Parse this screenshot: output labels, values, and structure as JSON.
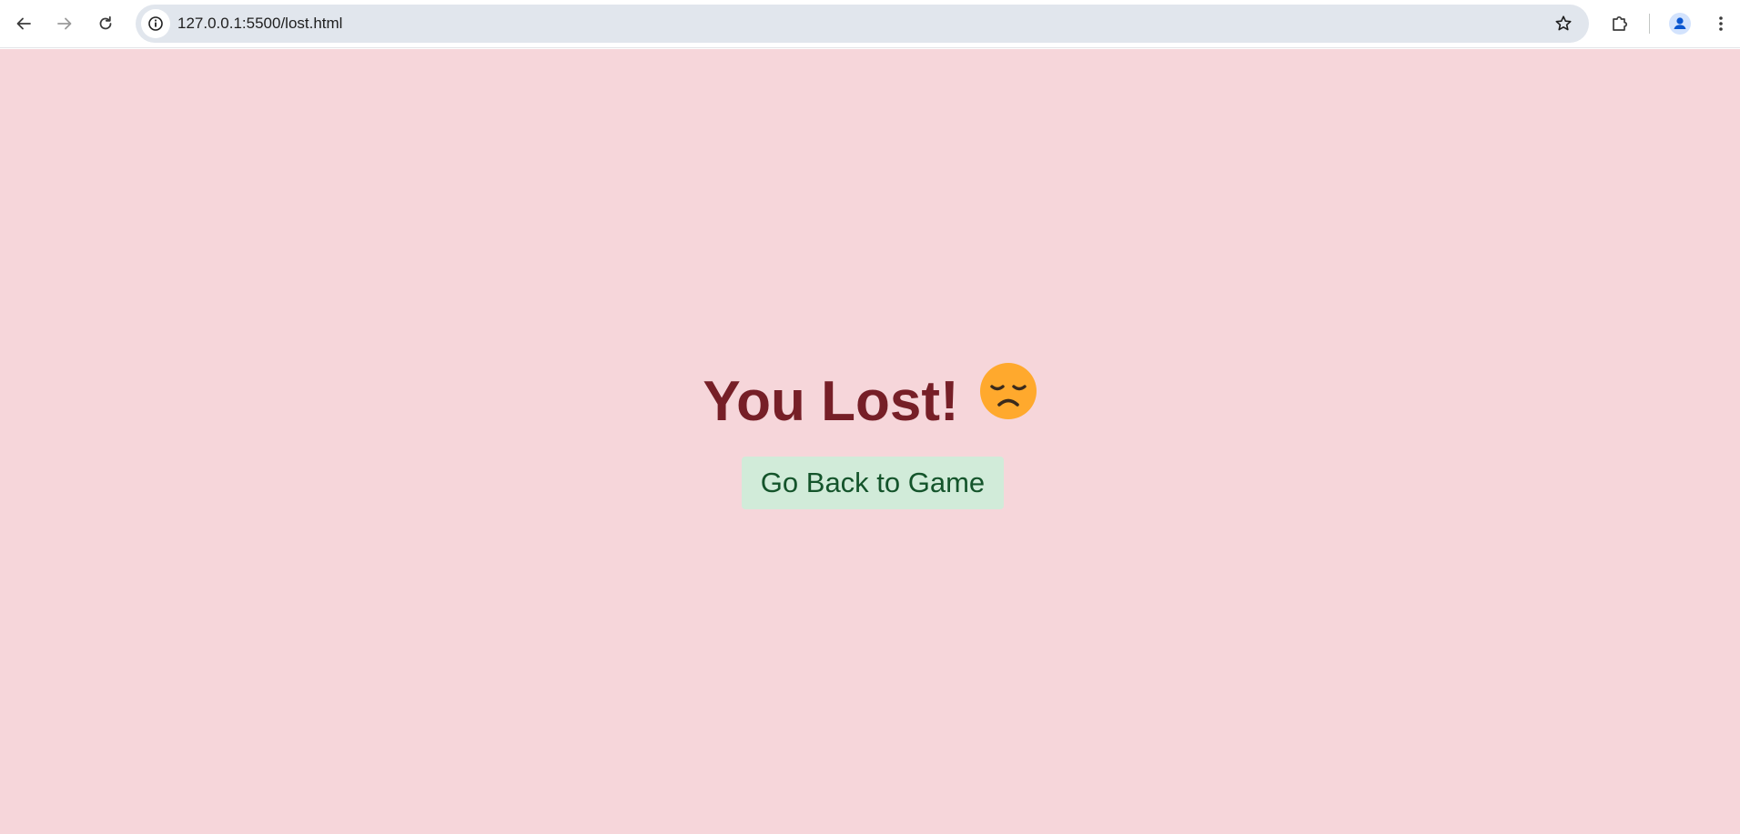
{
  "browser": {
    "url": "127.0.0.1:5500/lost.html",
    "icons": {
      "back": "arrow-left-icon",
      "forward": "arrow-right-icon",
      "reload": "reload-icon",
      "site_info": "info-icon",
      "bookmark": "star-icon",
      "extensions": "puzzle-icon",
      "profile": "account-icon",
      "menu": "kebab-menu-icon"
    }
  },
  "page": {
    "heading": "You Lost!",
    "emoji": "disappointed-face-icon",
    "back_button_label": "Go Back to Game",
    "colors": {
      "background": "#f6d6da",
      "heading": "#761f27",
      "button_bg": "#d1ebd9",
      "button_text": "#14542b"
    }
  }
}
